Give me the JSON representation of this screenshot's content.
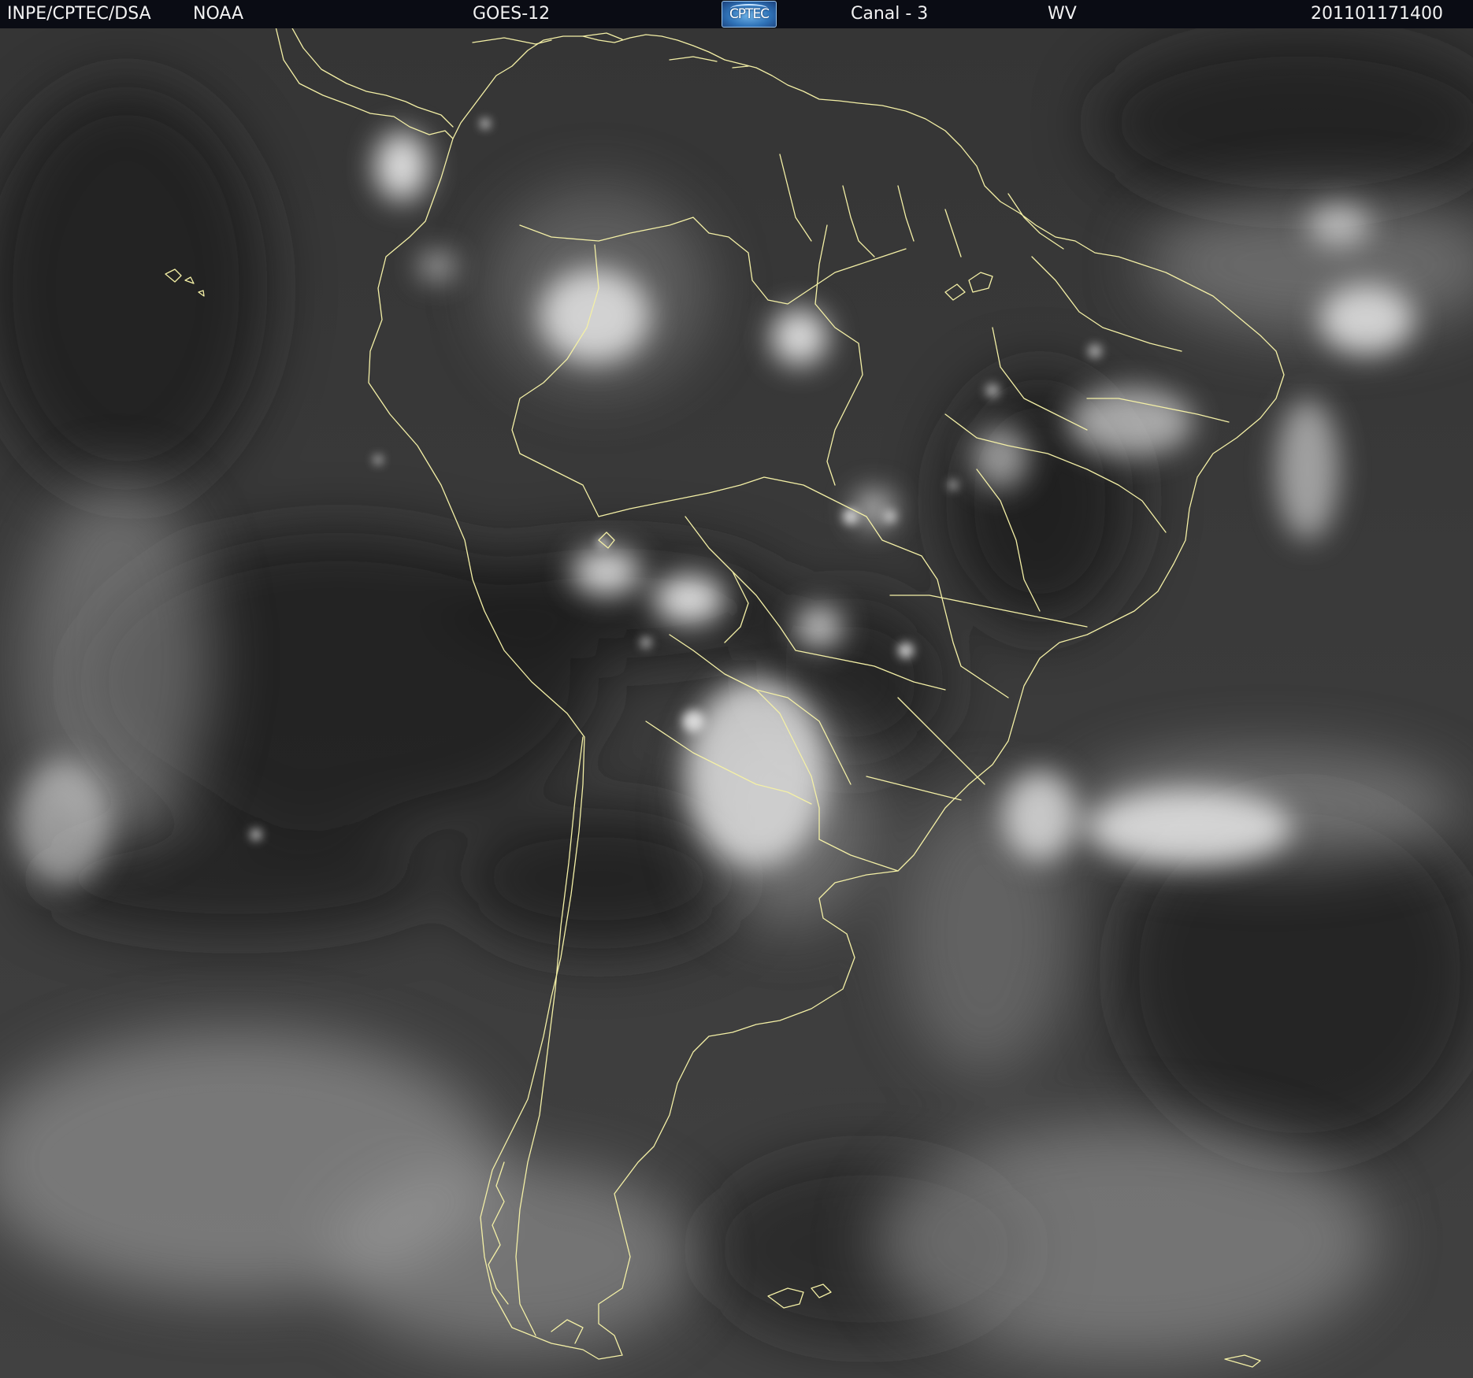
{
  "header": {
    "organization": "INPE/CPTEC/DSA",
    "agency": "NOAA",
    "satellite": "GOES-12",
    "logo_text": "CPTEC",
    "channel": "Canal - 3",
    "band": "WV",
    "timestamp": "201101171400"
  },
  "image": {
    "type": "water-vapor satellite image",
    "region": "South America",
    "colors": {
      "background_gray": "#3c3c3c",
      "dry_dark": "#151515",
      "moist_light": "#cfcfcf",
      "border_lines": "#f4f0a6",
      "header_bg": "#0a0c14"
    }
  }
}
